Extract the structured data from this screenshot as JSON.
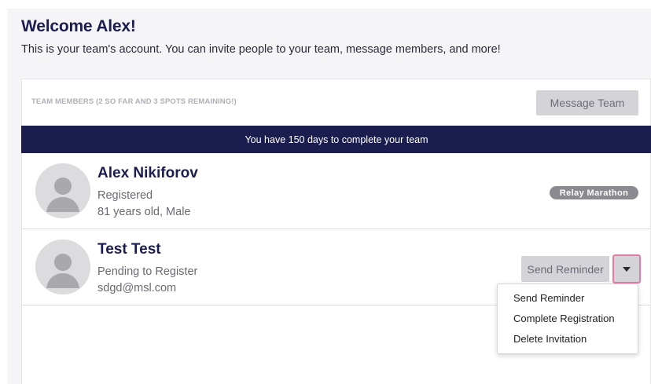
{
  "welcome": {
    "title": "Welcome Alex!",
    "subtitle": "This is your team's account. You can invite people to your team, message members, and more!"
  },
  "team": {
    "members_label": "TEAM MEMBERS (2 SO FAR AND 3 SPOTS REMAINING!)",
    "message_button": "Message Team",
    "banner": "You have 150 days to complete your team"
  },
  "members": [
    {
      "name": "Alex Nikiforov",
      "status": "Registered",
      "detail": "81 years old, Male",
      "badge": "Relay Marathon"
    },
    {
      "name": "Test Test",
      "status": "Pending to Register",
      "detail": "sdgd@msl.com",
      "action_button": "Send Reminder"
    }
  ],
  "dropdown": {
    "items": [
      "Send Reminder",
      "Complete Registration",
      "Delete Invitation"
    ]
  },
  "icons": {
    "avatar": "user-placeholder-icon",
    "dropdown": "caret-down-icon"
  },
  "colors": {
    "brand_navy": "#1c1d4f",
    "button_gray": "#d4d4d8",
    "focus_pink": "#e87aa8",
    "badge_gray": "#8a8a90"
  }
}
